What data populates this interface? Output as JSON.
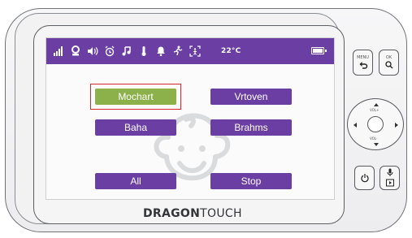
{
  "statusbar": {
    "icons": [
      "signal-icon",
      "camera-icon",
      "volume-icon",
      "alarm-icon",
      "music-icon",
      "thermometer-icon",
      "bell-icon",
      "vox-icon",
      "zoom-icon"
    ],
    "temperature": "22°C",
    "battery": "battery-full-icon"
  },
  "music_menu": {
    "buttons": [
      {
        "label": "Mochart",
        "selected": true
      },
      {
        "label": "Vrtoven",
        "selected": false
      },
      {
        "label": "Baha",
        "selected": false
      },
      {
        "label": "Brahms",
        "selected": false
      },
      {
        "label": "All",
        "selected": false
      },
      {
        "label": "Stop",
        "selected": false
      }
    ],
    "selected_color": "#8cb04a",
    "button_color": "#6b3ea3",
    "highlight_color": "#d7262d"
  },
  "brand": {
    "part1": "DRAGON",
    "part2": "TOUCH"
  },
  "controls": {
    "menu_label": "MENU",
    "ok_label": "OK",
    "vol_up_label": "VOL+",
    "vol_down_label": "VOL-"
  },
  "colors": {
    "accent": "#6b3ea3",
    "statusbar": "#6b3ea3"
  }
}
